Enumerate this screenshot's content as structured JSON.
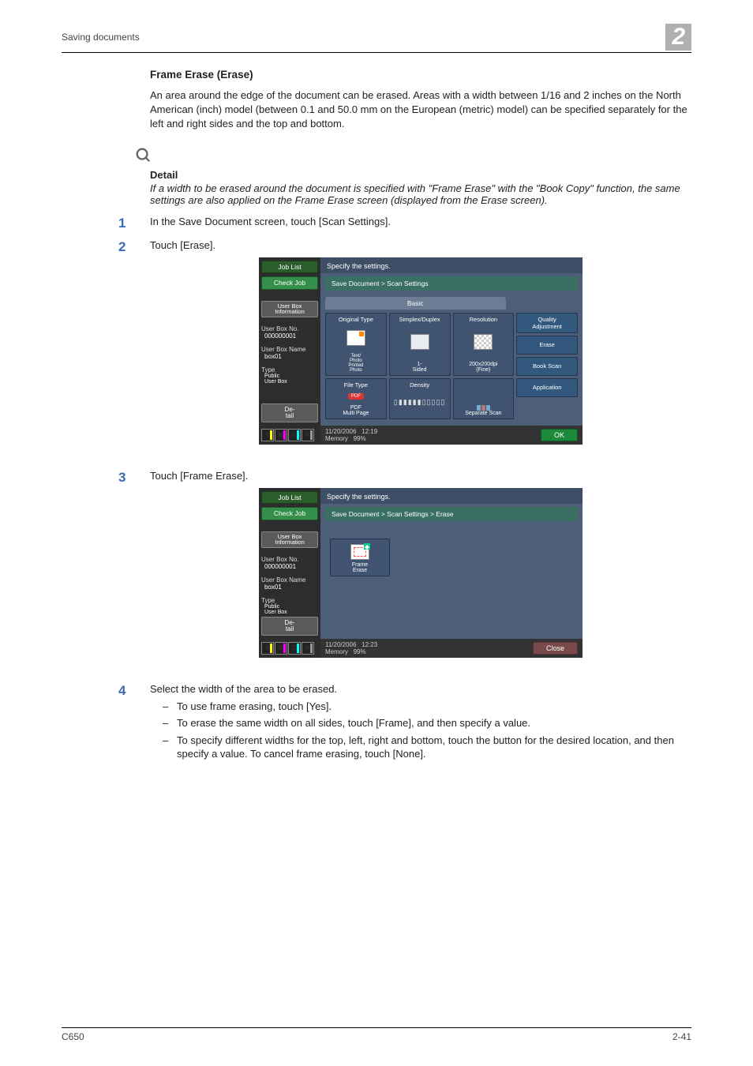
{
  "header": {
    "left": "Saving documents",
    "chapter": "2"
  },
  "section": {
    "title": "Frame Erase (Erase)",
    "intro": "An area around the edge of the document can be erased. Areas with a width between 1/16 and 2 inches on the North American (inch) model (between 0.1 and 50.0 mm on the European (metric) model) can be specified separately for the left and right sides and the top and bottom."
  },
  "detail": {
    "heading": "Detail",
    "text": "If a width to be erased around the document is specified with \"Frame Erase\" with the \"Book Copy\" function, the same settings are also applied on the Frame Erase screen (displayed from the Erase screen)."
  },
  "steps": {
    "s1": "In the Save Document screen, touch [Scan Settings].",
    "s2": "Touch [Erase].",
    "s3": "Touch [Frame Erase].",
    "s4": "Select the width of the area to be erased.",
    "s4_a": "To use frame erasing, touch [Yes].",
    "s4_b": "To erase the same width on all sides, touch [Frame], and then specify a value.",
    "s4_c": "To specify different widths for the top, left, right and bottom, touch the button for the desired location, and then specify a value. To cancel frame erasing, touch [None]."
  },
  "shot1": {
    "joblist": "Job List",
    "checkjob": "Check Job",
    "userboxinfo": "User Box\nInformation",
    "userboxno_l": "User Box No.",
    "userboxno_v": "000000001",
    "userboxname_l": "User Box Name",
    "userboxname_v": "box01",
    "type_l": "Type",
    "type_v": "Public\nUser Box",
    "detail": "De-\ntail",
    "specify": "Specify the settings.",
    "breadcrumb": "Save Document > Scan Settings",
    "tab": "Basic",
    "tiles": {
      "original": "Original Type",
      "original_sub": "Text/\nPhoto\nPrinted\nPhoto",
      "simplex": "Simplex/Duplex",
      "simplex_sub": "1-\nSided",
      "resolution": "Resolution",
      "resolution_sub": "200x200dpi\n(Fine)",
      "quality": "Quality\nAdjustment",
      "erase": "Erase",
      "bookscan": "Book Scan",
      "filetype": "File Type",
      "filetype_sub": "PDF\nMulti Page",
      "density": "Density",
      "application": "Application",
      "sepscan": "Separate Scan"
    },
    "date": "11/20/2006",
    "time": "12:19",
    "mem_l": "Memory",
    "mem_v": "99%",
    "ok": "OK"
  },
  "shot2": {
    "breadcrumb": "Save Document > Scan Settings > Erase",
    "frameerase": "Frame\nErase",
    "date": "11/20/2006",
    "time": "12:23",
    "close": "Close"
  },
  "footer": {
    "left": "C650",
    "right": "2-41"
  }
}
